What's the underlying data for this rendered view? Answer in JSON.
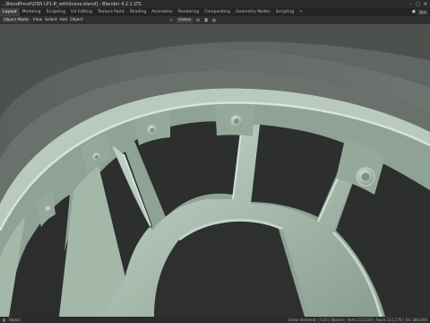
{
  "window": {
    "title": "...BlendProvit\\DSR LP1-R_withScene.blend] - Blender 4.2.1 LTS",
    "controls": [
      "–",
      "□",
      "✕"
    ]
  },
  "workspaces": {
    "tabs": [
      "Layout",
      "Modeling",
      "Sculpting",
      "UV Editing",
      "Texture Paint",
      "Shading",
      "Animation",
      "Rendering",
      "Compositing",
      "Geometry Nodes",
      "Scripting"
    ],
    "active": "Layout",
    "add_label": "+",
    "scene_label": "Sce"
  },
  "header": {
    "mode_label": "Object Mode",
    "menus": [
      "View",
      "Select",
      "Add",
      "Object"
    ],
    "transform_orientation": "Global"
  },
  "status": {
    "left_label": "Object",
    "stats": "Scene elements | 110 | Objects | Verts 113,116 | Faces 111,176 | Tris 384,000"
  },
  "colors": {
    "ui_dark": "#1d1d1d",
    "active_tab": "#3f3f3f",
    "wheel_surface": "#a9bcae",
    "tire": "#555a57",
    "background": "#2e3130"
  }
}
